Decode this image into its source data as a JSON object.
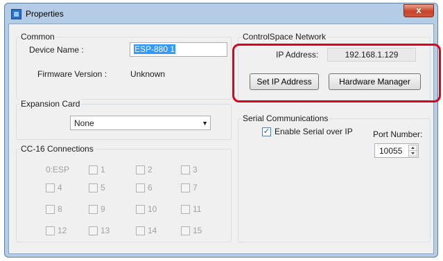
{
  "window": {
    "title": "Properties",
    "close_glyph": "x"
  },
  "common": {
    "title": "Common",
    "device_name_label": "Device Name :",
    "device_name_value": "ESP-880 1",
    "firmware_label": "Firmware Version :",
    "firmware_value": "Unknown"
  },
  "expansion": {
    "title": "Expansion Card",
    "selected": "None",
    "arrow": "▼"
  },
  "cc16": {
    "title": "CC-16 Connections",
    "first_label": "0:ESP",
    "items": [
      "1",
      "2",
      "3",
      "4",
      "5",
      "6",
      "7",
      "8",
      "9",
      "10",
      "11",
      "12",
      "13",
      "14",
      "15"
    ]
  },
  "network": {
    "title": "ControlSpace Network",
    "ip_label": "IP Address:",
    "ip_value": "192.168.1.129",
    "set_ip_button": "Set IP Address",
    "hardware_button": "Hardware Manager"
  },
  "serial": {
    "title": "Serial Communications",
    "enable_label": "Enable Serial over IP",
    "enabled": true,
    "check_glyph": "✓",
    "port_label": "Port Number:",
    "port_value": "10055"
  },
  "colors": {
    "selection": "#3399ff",
    "highlight_border": "#e0001b",
    "title_bar": "#b4cce6"
  }
}
